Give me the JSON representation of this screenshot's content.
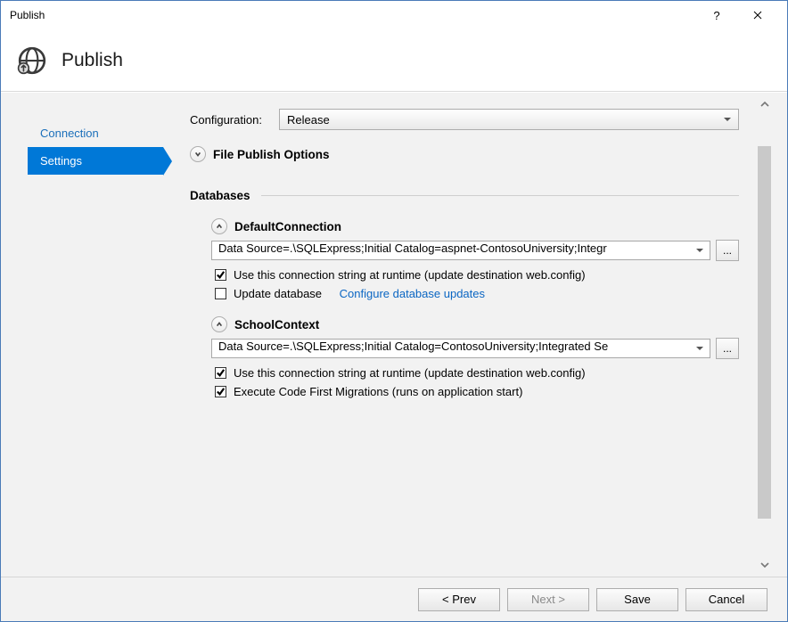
{
  "window": {
    "title": "Publish",
    "help": "?",
    "close": "×"
  },
  "header": {
    "title": "Publish"
  },
  "sidebar": {
    "items": [
      {
        "label": "Connection",
        "name": "sidebar-item-connection",
        "active": false
      },
      {
        "label": "Settings",
        "name": "sidebar-item-settings",
        "active": true
      }
    ]
  },
  "settings": {
    "config_label": "Configuration:",
    "config_value": "Release",
    "file_publish_options_label": "File Publish Options",
    "databases_label": "Databases",
    "dbs": [
      {
        "title": "DefaultConnection",
        "connection": "Data Source=.\\SQLExpress;Initial Catalog=aspnet-ContosoUniversity;Integr",
        "options": [
          {
            "label": "Use this connection string at runtime (update destination web.config)",
            "checked": true
          },
          {
            "label": "Update database",
            "checked": false,
            "link": "Configure database updates"
          }
        ]
      },
      {
        "title": "SchoolContext",
        "connection": "Data Source=.\\SQLExpress;Initial Catalog=ContosoUniversity;Integrated Se",
        "options": [
          {
            "label": "Use this connection string at runtime (update destination web.config)",
            "checked": true
          },
          {
            "label": "Execute Code First Migrations (runs on application start)",
            "checked": true
          }
        ]
      }
    ]
  },
  "footer": {
    "prev": "< Prev",
    "next": "Next >",
    "save": "Save",
    "cancel": "Cancel"
  }
}
